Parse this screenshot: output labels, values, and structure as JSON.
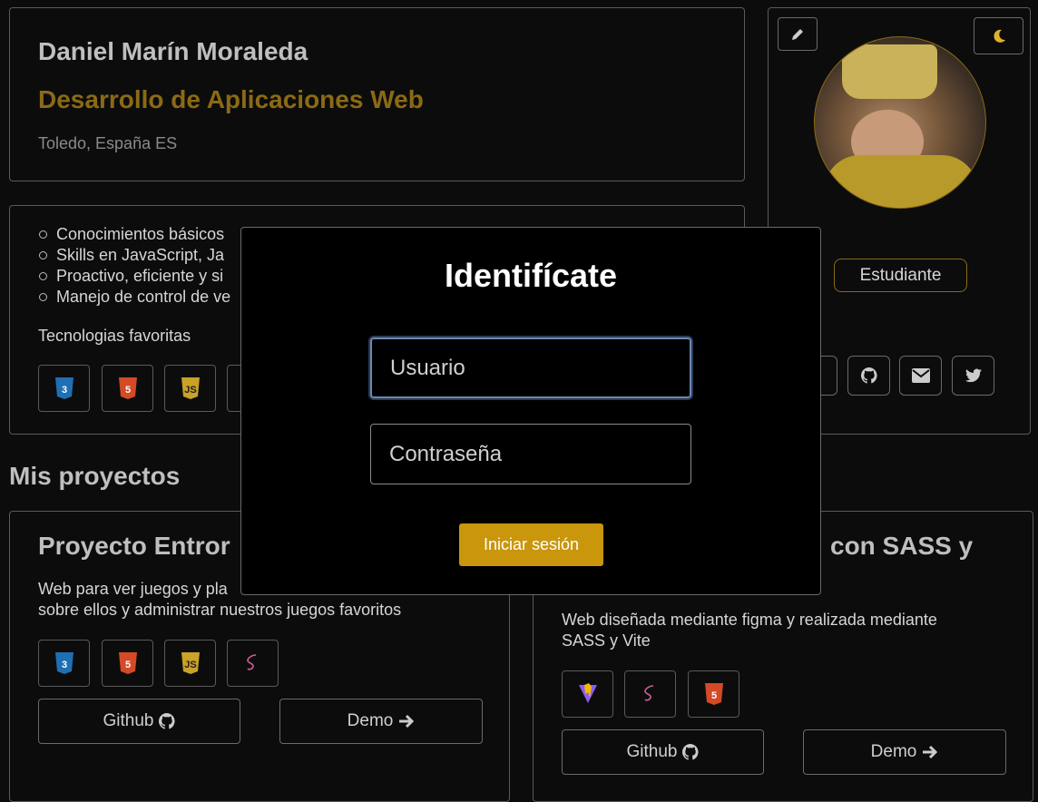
{
  "profile": {
    "name": "Daniel Marín Moraleda",
    "role": "Desarrollo de Aplicaciones Web",
    "location": "Toledo, España ES",
    "badge": "Estudiante"
  },
  "skills": {
    "items": [
      "Conocimientos básicos",
      "Skills en JavaScript, Ja",
      "Proactivo, eficiente y si",
      "Manejo de control de ve"
    ],
    "favorites_label": "Tecnologias favoritas"
  },
  "projects": {
    "section_title": "Mis proyectos",
    "cards": [
      {
        "title": "Proyecto Entror",
        "description_line1": "Web para ver juegos y pla",
        "description_line2": "sobre ellos y administrar nuestros juegos favoritos",
        "github_label": "Github",
        "demo_label": "Demo"
      },
      {
        "title": "con SASS y",
        "description_line1": "Web diseñada mediante figma y realizada mediante",
        "description_line2": "SASS y Vite",
        "github_label": "Github",
        "demo_label": "Demo"
      }
    ]
  },
  "login": {
    "title": "Identifícate",
    "username_placeholder": "Usuario",
    "password_placeholder": "Contraseña",
    "submit_label": "Iniciar sesión"
  },
  "icons": [
    "pencil-icon",
    "moon-icon",
    "github-icon",
    "envelope-icon",
    "twitter-icon",
    "css3-icon",
    "html5-icon",
    "js-icon",
    "sass-icon",
    "vite-icon",
    "arrow-right-icon"
  ],
  "colors": {
    "accent": "#c9960c",
    "accent_dim": "#8a6a14",
    "background": "#0c0c0c"
  }
}
